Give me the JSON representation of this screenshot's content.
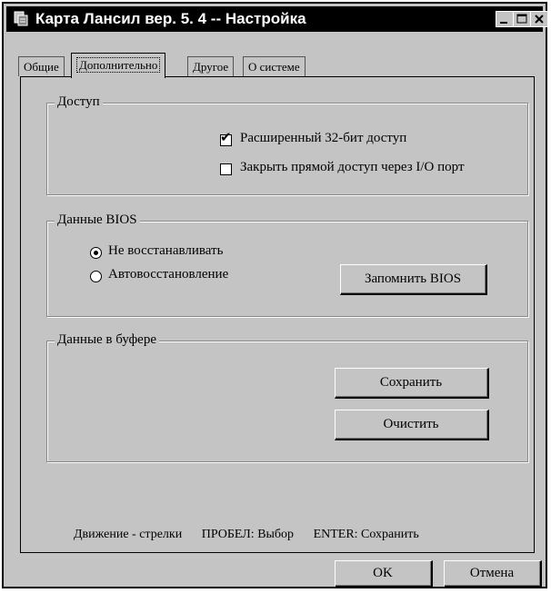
{
  "window": {
    "title": "Карта Лансил вер. 5. 4 -- Настройка",
    "controls": {
      "minimize": "_",
      "maximize": "□",
      "close": "×"
    }
  },
  "tabs": [
    {
      "label": "Общие",
      "active": false
    },
    {
      "label": "Дополнительно",
      "active": true
    },
    {
      "label": "Другое",
      "active": false
    },
    {
      "label": "О системе",
      "active": false
    }
  ],
  "access_group": {
    "legend": "Доступ",
    "ext32": {
      "label": "Расширенный 32-бит доступ",
      "checked": true
    },
    "close_io": {
      "label": "Закрыть прямой доступ через I/O порт",
      "checked": false
    }
  },
  "bios_group": {
    "legend": "Данные BIOS",
    "no_restore": {
      "label": "Не восстанавливать",
      "selected": true
    },
    "auto_restore": {
      "label": "Автовосстановление",
      "selected": false
    },
    "remember_button": "Запомнить BIOS"
  },
  "buffer_group": {
    "legend": "Данные в буфере",
    "save_button": "Сохранить",
    "clear_button": "Очистить"
  },
  "hints": {
    "move": "Движение - стрелки",
    "space": "ПРОБЕЛ: Выбор",
    "enter": "ENTER: Сохранить"
  },
  "footer": {
    "ok": "OK",
    "cancel": "Отмена"
  }
}
